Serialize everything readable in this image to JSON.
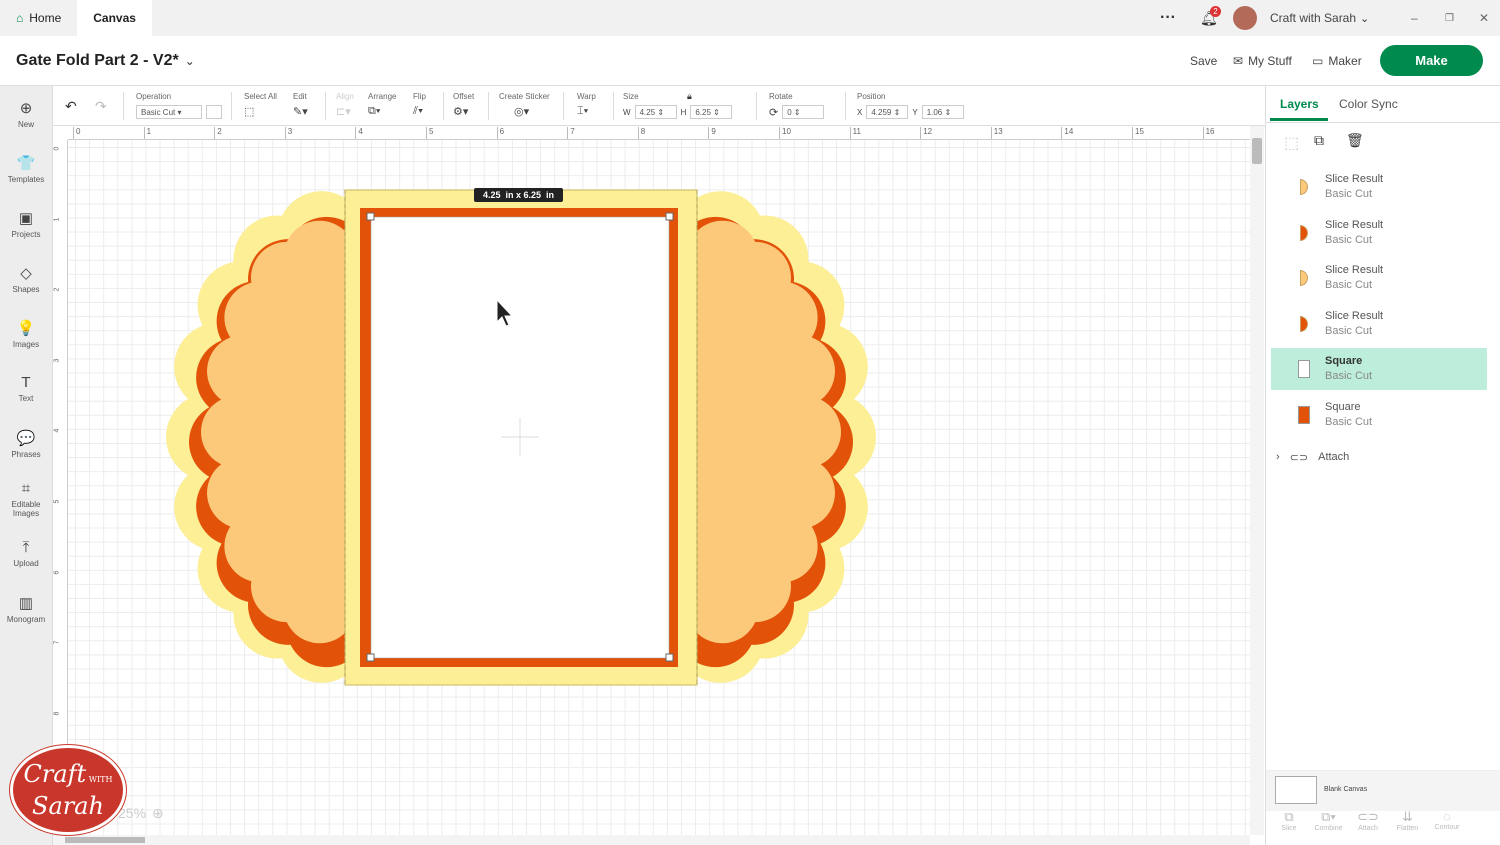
{
  "tabs": [
    {
      "label": "Home"
    },
    {
      "label": "Canvas"
    }
  ],
  "notifications": {
    "count": "2"
  },
  "user": {
    "name": "Craft with Sarah"
  },
  "title": "Gate Fold Part 2 - V2*",
  "header": {
    "save": "Save",
    "my_stuff": "My Stuff",
    "maker": "Maker",
    "make": "Make"
  },
  "sidebar": [
    {
      "label": "New",
      "icon": "⊕"
    },
    {
      "label": "Templates",
      "icon": "👕"
    },
    {
      "label": "Projects",
      "icon": "▣"
    },
    {
      "label": "Shapes",
      "icon": "◇"
    },
    {
      "label": "Images",
      "icon": "💡"
    },
    {
      "label": "Text",
      "icon": "T"
    },
    {
      "label": "Phrases",
      "icon": "💬"
    },
    {
      "label": "Editable Images",
      "icon": "⌗"
    },
    {
      "label": "Upload",
      "icon": "⤒"
    },
    {
      "label": "Monogram",
      "icon": "▥"
    }
  ],
  "toolbar": {
    "operation_label": "Operation",
    "operation_value": "Basic Cut",
    "select_all": "Select All",
    "edit": "Edit",
    "align": "Align",
    "arrange": "Arrange",
    "flip": "Flip",
    "offset": "Offset",
    "create_sticker": "Create Sticker",
    "warp": "Warp",
    "size": "Size",
    "w_label": "W",
    "w": "4.25",
    "h_label": "H",
    "h": "6.25",
    "rotate": "Rotate",
    "rotate_value": "0",
    "position": "Position",
    "x_label": "X",
    "x": "4.259",
    "y_label": "Y",
    "y": "1.06"
  },
  "ruler_h": [
    "0",
    "1",
    "2",
    "3",
    "4",
    "5",
    "6",
    "7",
    "8",
    "9",
    "10",
    "11",
    "12",
    "13",
    "14",
    "15",
    "16"
  ],
  "ruler_v": [
    "0",
    "1",
    "2",
    "3",
    "4",
    "5",
    "6",
    "7",
    "8"
  ],
  "size_tooltip": "4.25  in x 6.25  in",
  "zoom": "25%",
  "colors": {
    "light_yellow": "#fcef96",
    "orange": "#e25209",
    "peach": "#fcc97a",
    "accent": "#008a4e"
  },
  "panel": {
    "tabs": [
      "Layers",
      "Color Sync"
    ],
    "layers": [
      {
        "name": "Slice Result",
        "op": "Basic Cut",
        "color": "#fcc97a"
      },
      {
        "name": "Slice Result",
        "op": "Basic Cut",
        "color": "#e25209"
      },
      {
        "name": "Slice Result",
        "op": "Basic Cut",
        "color": "#fcc97a"
      },
      {
        "name": "Slice Result",
        "op": "Basic Cut",
        "color": "#e25209"
      },
      {
        "name": "Square",
        "op": "Basic Cut",
        "color": "#ffffff",
        "selected": true
      },
      {
        "name": "Square",
        "op": "Basic Cut",
        "color": "#e25209"
      }
    ],
    "attach": "Attach",
    "blank_canvas": "Blank Canvas",
    "bottom_tools": [
      "Slice",
      "Combine",
      "Attach",
      "Flatten",
      "Contour"
    ]
  },
  "logo": {
    "line1": "Craft",
    "with": "WITH",
    "line2": "Sarah"
  }
}
